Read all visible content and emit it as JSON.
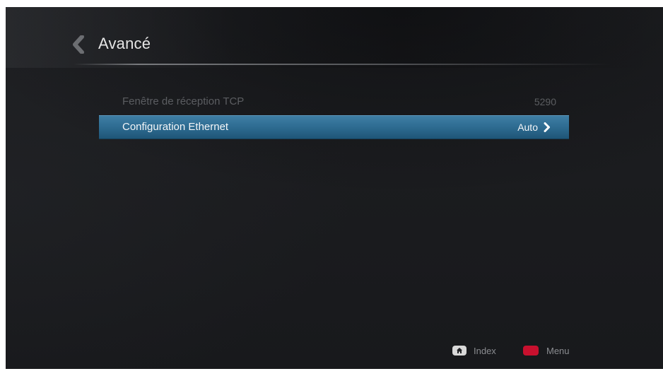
{
  "header": {
    "title": "Avancé"
  },
  "settings": [
    {
      "label": "Fenêtre de réception TCP",
      "value": "5290",
      "state": "disabled"
    },
    {
      "label": "Configuration Ethernet",
      "value": "Auto",
      "state": "selected"
    }
  ],
  "footer": {
    "index_label": "Index",
    "menu_label": "Menu"
  },
  "colors": {
    "selection": "#2f6d93",
    "red_key": "#c8102e",
    "disabled_text": "#5b5d61"
  },
  "icons": {
    "back": "chevron-left-icon",
    "row_arrow": "chevron-right-icon",
    "index_key": "home-icon",
    "menu_key": "red-button-icon"
  }
}
